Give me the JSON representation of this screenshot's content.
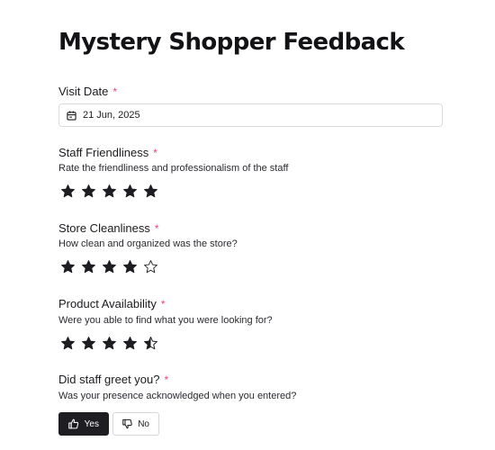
{
  "form": {
    "title": "Mystery Shopper Feedback",
    "required_marker": "*",
    "visit_date": {
      "label": "Visit Date",
      "value": "21 Jun, 2025",
      "icon": "calendar-icon"
    },
    "staff_friendliness": {
      "label": "Staff Friendliness",
      "description": "Rate the friendliness and professionalism of the staff",
      "rating": 5,
      "max": 5
    },
    "store_cleanliness": {
      "label": "Store Cleanliness",
      "description": "How clean and organized was the store?",
      "rating": 4,
      "max": 5
    },
    "product_availability": {
      "label": "Product Availability",
      "description": "Were you able to find what you were looking for?",
      "rating": 4.5,
      "max": 5
    },
    "greeting": {
      "label": "Did staff greet you?",
      "description": "Was your presence acknowledged when you entered?",
      "yes_label": "Yes",
      "no_label": "No",
      "selected": "Yes"
    }
  },
  "colors": {
    "required": "#e8437a",
    "star": "#1d1d22",
    "selected_button": "#1d1d22"
  }
}
